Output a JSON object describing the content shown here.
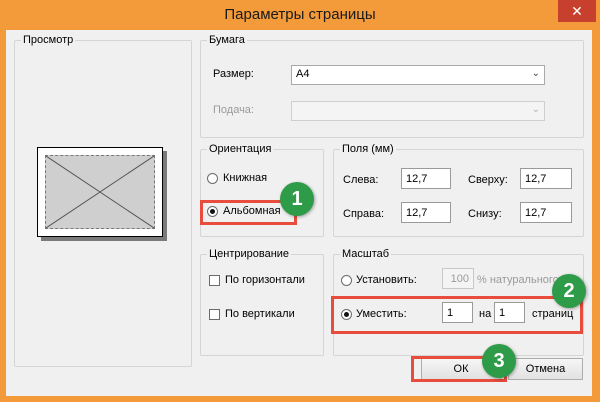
{
  "window": {
    "title": "Параметры страницы",
    "close_glyph": "✕"
  },
  "preview": {
    "label": "Просмотр"
  },
  "paper": {
    "label": "Бумага",
    "size_label": "Размер:",
    "size_value": "A4",
    "source_label": "Подача:",
    "source_value": ""
  },
  "orientation": {
    "label": "Ориентация",
    "portrait_label": "Книжная",
    "landscape_label": "Альбомная",
    "selected": "landscape"
  },
  "margins": {
    "label": "Поля (мм)",
    "left_label": "Слева:",
    "left_value": "12,7",
    "top_label": "Сверху:",
    "top_value": "12,7",
    "right_label": "Справа:",
    "right_value": "12,7",
    "bottom_label": "Снизу:",
    "bottom_value": "12,7"
  },
  "centering": {
    "label": "Центрирование",
    "horizontal_label": "По горизонтали",
    "vertical_label": "По вертикали"
  },
  "scale": {
    "label": "Масштаб",
    "adjust_label": "Установить:",
    "adjust_value": "100",
    "adjust_suffix": "% натурального",
    "fit_label": "Уместить:",
    "fit_wide_value": "1",
    "fit_on": "на",
    "fit_tall_value": "1",
    "fit_pages": "страниц"
  },
  "buttons": {
    "ok": "ОК",
    "cancel": "Отмена"
  },
  "annotations": {
    "badge1": "1",
    "badge2": "2",
    "badge3": "3",
    "highlight_color": "#e74c3c",
    "badge_color": "#2d9b47"
  },
  "colors": {
    "titlebar": "#f39a3a",
    "close": "#c7402e"
  }
}
